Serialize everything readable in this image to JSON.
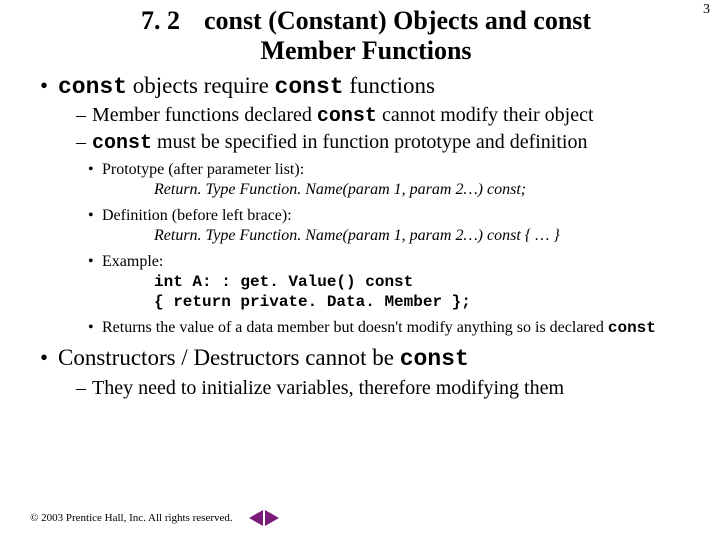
{
  "page_number": "3",
  "title": {
    "section": "7. 2",
    "line1": "const (Constant) Objects and const",
    "line2": "Member Functions"
  },
  "bullets": {
    "b1": {
      "pre": "const",
      "mid": " objects require ",
      "post": "const",
      "tail": " functions"
    },
    "b1_dash1": {
      "pre": "Member functions declared ",
      "code": "const",
      "tail": " cannot modify their object"
    },
    "b1_dash2": {
      "code": "const",
      "tail": " must be specified in function prototype and definition"
    },
    "proto_label": "Prototype (after parameter list):",
    "proto_code": "Return. Type Function. Name(param 1, param 2…) const;",
    "def_label": "Definition (before left brace):",
    "def_code": "Return. Type Function. Name(param 1, param 2…) const { … }",
    "ex_label": "Example:",
    "ex_code1": "int A: : get. Value() const",
    "ex_code2": "   { return private. Data. Member };",
    "ret_text_pre": "Returns the value of a data member but doesn't modify anything so is declared ",
    "ret_code": "const",
    "b2_pre": "Constructors / Destructors cannot be ",
    "b2_code": "const",
    "b2_dash": "They need to initialize variables, therefore modifying them"
  },
  "footer": {
    "copyright": "© 2003 Prentice Hall, Inc. All rights reserved."
  }
}
